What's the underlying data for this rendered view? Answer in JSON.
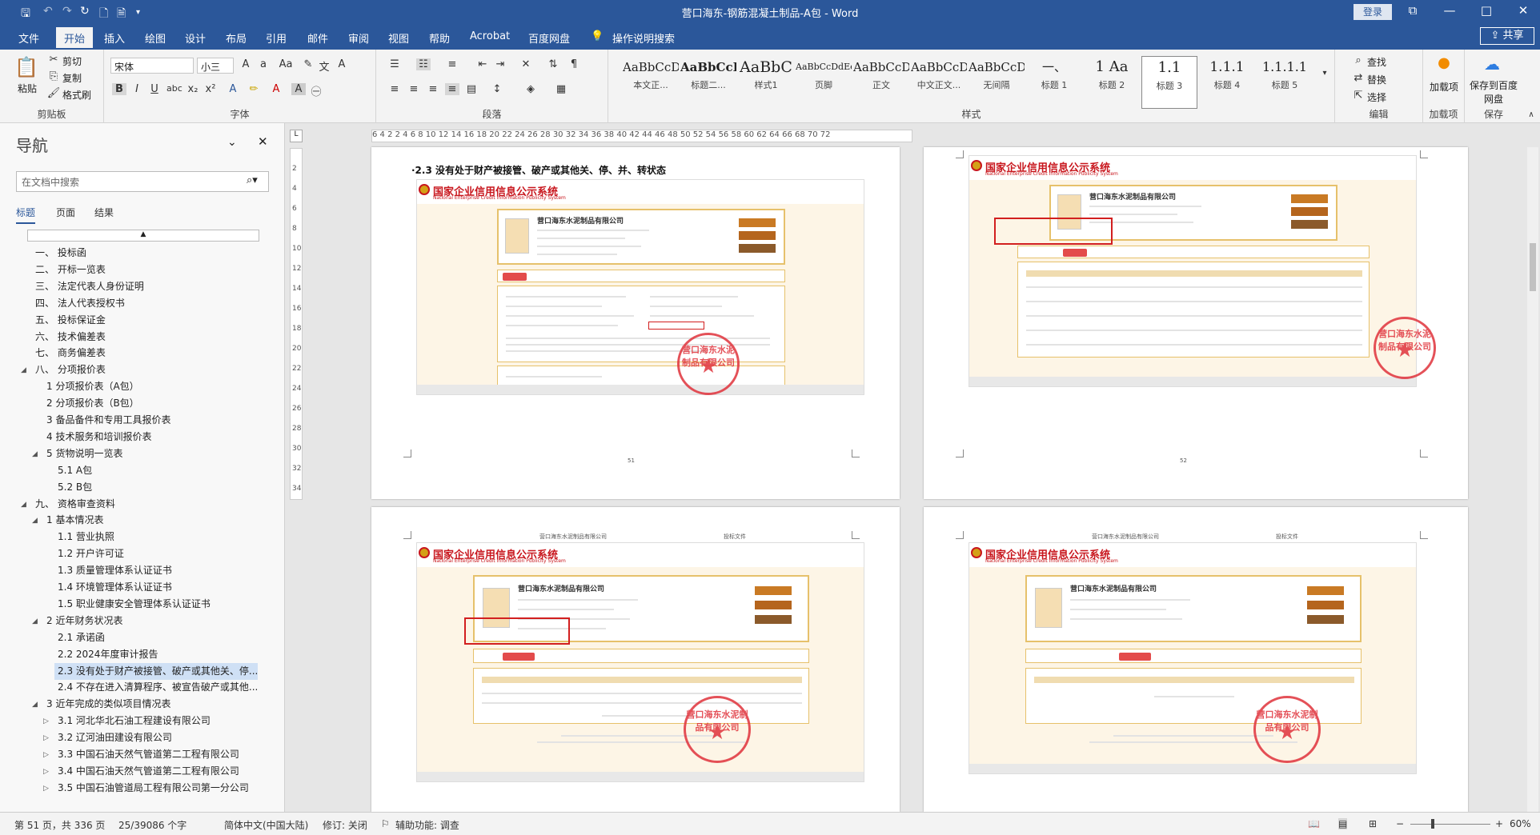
{
  "window": {
    "title": "营口海东-钢筋混凝土制品-A包  -  Word",
    "login_label": "登录"
  },
  "tabs": [
    "文件",
    "开始",
    "插入",
    "绘图",
    "设计",
    "布局",
    "引用",
    "邮件",
    "审阅",
    "视图",
    "帮助",
    "Acrobat",
    "百度网盘"
  ],
  "tell_me": "操作说明搜索",
  "share_label": "共享",
  "ribbon": {
    "clipboard": {
      "paste": "粘贴",
      "cut": "剪切",
      "copy": "复制",
      "format_painter": "格式刷",
      "label": "剪贴板"
    },
    "font": {
      "name": "宋体",
      "size": "小三",
      "label": "字体"
    },
    "paragraph": {
      "label": "段落"
    },
    "styles": {
      "label": "样式",
      "items": [
        {
          "preview": "AaBbCcDdI",
          "name": "本文正..."
        },
        {
          "preview": "AaBbCcD",
          "name": "标题二..."
        },
        {
          "preview": "AaBbC",
          "name": "样式1"
        },
        {
          "preview": "AaBbCcDdEe",
          "name": "页脚"
        },
        {
          "preview": "AaBbCcDdI",
          "name": "正文"
        },
        {
          "preview": "AaBbCcD",
          "name": "中文正文..."
        },
        {
          "preview": "AaBbCcDdI",
          "name": "无间隔"
        },
        {
          "preview": "一、",
          "name": "标题 1"
        },
        {
          "preview": "1 Aa",
          "name": "标题 2"
        },
        {
          "preview": "1.1",
          "name": "标题 3"
        },
        {
          "preview": "1.1.1",
          "name": "标题 4"
        },
        {
          "preview": "1.1.1.1",
          "name": "标题 5"
        }
      ]
    },
    "editing": {
      "find": "查找",
      "replace": "替换",
      "select": "选择",
      "label": "编辑"
    },
    "addins": {
      "name": "加载项",
      "label": "加载项"
    },
    "save": {
      "name": "保存到百度网盘",
      "label": "保存"
    }
  },
  "nav": {
    "title": "导航",
    "search_placeholder": "在文档中搜索",
    "tabs": [
      "标题",
      "页面",
      "结果"
    ],
    "items": [
      {
        "text": "一、 投标函",
        "level": 1
      },
      {
        "text": "二、 开标一览表",
        "level": 1
      },
      {
        "text": "三、 法定代表人身份证明",
        "level": 1
      },
      {
        "text": "四、 法人代表授权书",
        "level": 1
      },
      {
        "text": "五、 投标保证金",
        "level": 1
      },
      {
        "text": "六、 技术偏差表",
        "level": 1
      },
      {
        "text": "七、 商务偏差表",
        "level": 1
      },
      {
        "text": "八、 分项报价表",
        "level": 1
      },
      {
        "text": "1 分项报价表（A包）",
        "level": 2
      },
      {
        "text": "2 分项报价表（B包）",
        "level": 2
      },
      {
        "text": "3 备品备件和专用工具报价表",
        "level": 2
      },
      {
        "text": "4 技术服务和培训报价表",
        "level": 2
      },
      {
        "text": "5 货物说明一览表",
        "level": 2
      },
      {
        "text": "5.1 A包",
        "level": 3
      },
      {
        "text": "5.2 B包",
        "level": 3
      },
      {
        "text": "九、 资格审查资料",
        "level": 1
      },
      {
        "text": "1 基本情况表",
        "level": 2
      },
      {
        "text": "1.1 营业执照",
        "level": 3
      },
      {
        "text": "1.2 开户许可证",
        "level": 3
      },
      {
        "text": "1.3 质量管理体系认证证书",
        "level": 3
      },
      {
        "text": "1.4 环境管理体系认证证书",
        "level": 3
      },
      {
        "text": "1.5 职业健康安全管理体系认证证书",
        "level": 3
      },
      {
        "text": "2 近年财务状况表",
        "level": 2
      },
      {
        "text": "2.1 承诺函",
        "level": 3
      },
      {
        "text": "2.2  2024年度审计报告",
        "level": 3
      },
      {
        "text": "2.3 没有处于财产被接管、破产或其他关、停...",
        "level": 3
      },
      {
        "text": "2.4 不存在进入清算程序、被宣告破产或其他...",
        "level": 3
      },
      {
        "text": "3 近年完成的类似项目情况表",
        "level": 2
      },
      {
        "text": "3.1 河北华北石油工程建设有限公司",
        "level": 3
      },
      {
        "text": "3.2 辽河油田建设有限公司",
        "level": 3
      },
      {
        "text": "3.3 中国石油天然气管道第二工程有限公司",
        "level": 3
      },
      {
        "text": "3.4 中国石油天然气管道第二工程有限公司",
        "level": 3
      },
      {
        "text": "3.5 中国石油管道局工程有限公司第一分公司",
        "level": 3
      }
    ]
  },
  "ruler_ticks": "6  4  2     2  4  6  8  10  12  14  16  18  20  22  24  26  28  30  32  34  36  38  40  42  44  46  48  50  52  54  56  58  60  62  64  66  68  70  72",
  "document": {
    "heading": "·2.3 没有处于财产被接管、破产或其他关、停、并、转状态",
    "page_header_left": "营口海东水泥制品有限公司",
    "page_header_right": "投标文件",
    "site_title": "国家企业信用信息公示系统",
    "site_en": "National Enterprise Credit Information Publicity System",
    "company": "营口海东水泥制品有限公司",
    "seal_text": "营口海东水泥制品有限公司",
    "page_nums": [
      "51",
      "52"
    ]
  },
  "status": {
    "page": "第 51 页，共 336 页",
    "words": "25/39086 个字",
    "lang": "简体中文(中国大陆)",
    "track": "修订: 关闭",
    "access": "辅助功能: 调查",
    "zoom": "60%"
  }
}
